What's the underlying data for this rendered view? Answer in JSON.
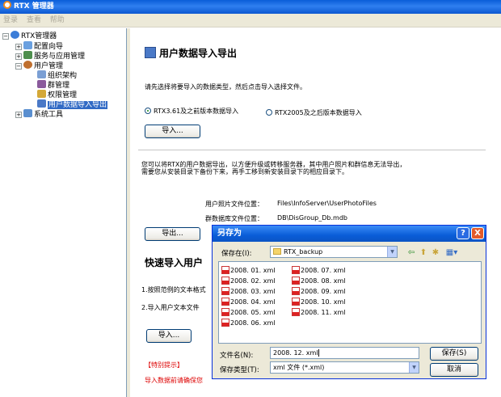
{
  "window": {
    "title": "RTX 管理器"
  },
  "menu": [
    "登录",
    "查看",
    "帮助"
  ],
  "tree": {
    "root": "RTX管理器",
    "items": [
      {
        "label": "配置向导"
      },
      {
        "label": "服务与应用管理"
      },
      {
        "label": "用户管理"
      },
      {
        "label": "组织架构"
      },
      {
        "label": "群管理"
      },
      {
        "label": "权限管理"
      },
      {
        "label": "用户数据导入导出"
      },
      {
        "label": "系统工具"
      }
    ]
  },
  "main": {
    "title": "用户数据导入导出",
    "instruction": "请先选择将要导入的数据类型，然后点击导入选择文件。",
    "radio1": "RTX3.61及之前版本数据导入",
    "radio2": "RTX2005及之后版本数据导入",
    "import_btn": "导入...",
    "export_desc1": "您可以将RTX的用户数据导出，以方便升级或转移服务器，其中用户照片和群信息无法导出，",
    "export_desc2": "需要您从安装目录下备份下来，再手工移到新安装目录下的相应目录下。",
    "photo_label": "用户照片文件位置：",
    "photo_path": "Files\\InfoServer\\UserPhotoFiles",
    "db_label": "群数据库文件位置：",
    "db_path": "DB\\DisGroup_Db.mdb",
    "export_btn": "导出...",
    "quick_title": "快速导入用户",
    "step1": "1.按照范例的文本格式",
    "step2": "2.导入用户文本文件",
    "import_btn2": "导入...",
    "notice_title": "【特别提示】",
    "notice_text": "导入数据前请确保您"
  },
  "dialog": {
    "title": "另存为",
    "help": "?",
    "close": "X",
    "save_in_label": "保存在(I):",
    "save_in_value": "RTX_backup",
    "files_col1": [
      "2008. 01. xml",
      "2008. 02. xml",
      "2008. 03. xml",
      "2008. 04. xml",
      "2008. 05. xml",
      "2008. 06. xml"
    ],
    "files_col2": [
      "2008. 07. xml",
      "2008. 08. xml",
      "2008. 09. xml",
      "2008. 10. xml",
      "2008. 11. xml"
    ],
    "filename_label": "文件名(N):",
    "filename_value": "2008. 12. xml",
    "filetype_label": "保存类型(T):",
    "filetype_value": "xml 文件 (*.xml)",
    "save_btn": "保存(S)",
    "cancel_btn": "取消"
  }
}
